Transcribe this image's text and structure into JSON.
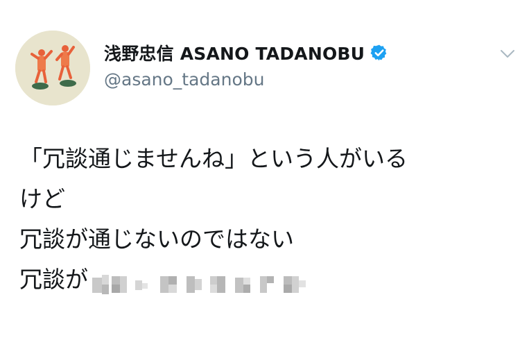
{
  "author": {
    "display_name": "浅野忠信 ASANO TADANOBU",
    "handle": "@asano_tadanobu",
    "verified": true
  },
  "tweet": {
    "lines": [
      "「冗談通じませんね」という人がいる",
      "けど",
      "冗談が通じないのではない",
      "冗談が"
    ],
    "redacted_after_last_line": true
  },
  "icons": {
    "verified": "verified-badge-icon",
    "menu": "chevron-down-icon"
  },
  "colors": {
    "verified_blue": "#1da1f2",
    "handle_gray": "#657786",
    "text": "#14171a",
    "caret_gray": "#aab8c2"
  }
}
